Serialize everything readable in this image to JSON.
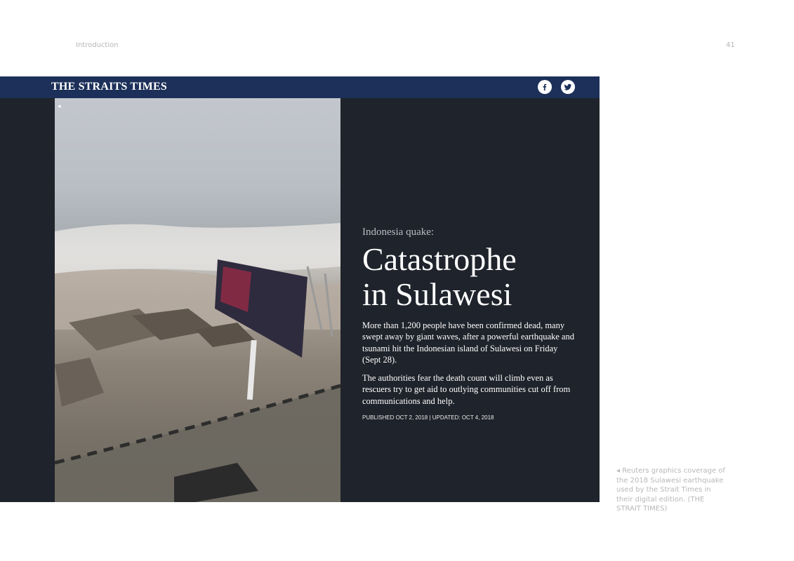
{
  "page": {
    "section": "Introduction",
    "number": "41"
  },
  "screenshot": {
    "brand": "THE STRAITS TIMES",
    "social_icons": [
      "facebook-icon",
      "twitter-icon"
    ],
    "back_arrow": "◂",
    "kicker": "Indonesia quake:",
    "headline_line1": "Catastrophe",
    "headline_line2": "in Sulawesi",
    "paragraph1": "More than 1,200 people have been confirmed dead, many swept away by giant waves, after a powerful earthquake and tsunami hit the Indonesian island of Sulawesi on Friday (Sept 28).",
    "paragraph2": "The authorities fear the death count will climb even as rescuers try to get aid to outlying communities cut off from communications and help.",
    "published": "PUBLISHED OCT 2, 2018 | UPDATED: OCT 4, 2018",
    "colors": {
      "topbar": "#1c3059",
      "background": "#1f232b"
    }
  },
  "caption": "◂ Reuters graphics coverage of the 2018 Sulawesi earthquake used by the Strait Times in their digital edition. (THE STRAIT TIMES)"
}
